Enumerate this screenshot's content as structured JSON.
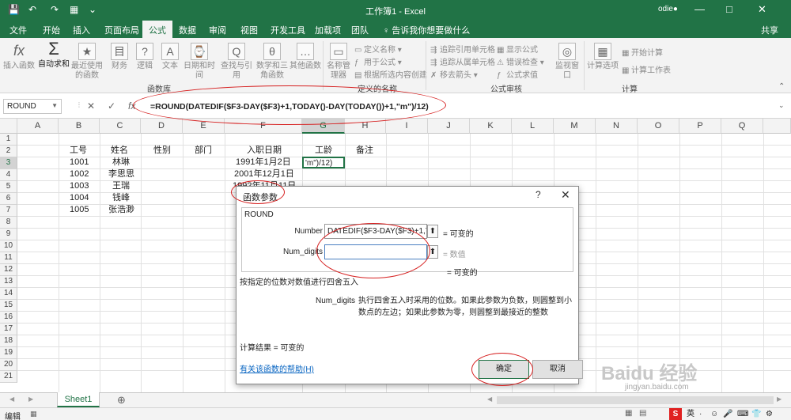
{
  "titlebar": {
    "title": "工作簿1 - Excel",
    "user": "odie●",
    "window_controls": [
      "—",
      "□",
      "✕"
    ]
  },
  "tabs": [
    "文件",
    "开始",
    "插入",
    "页面布局",
    "公式",
    "数据",
    "审阅",
    "视图",
    "开发工具",
    "加载项",
    "团队",
    "♀ 告诉我你想要做什么"
  ],
  "active_tab": "公式",
  "share": "共享",
  "ribbon": {
    "funclib": [
      {
        "icon": "fx",
        "label": "插入函数"
      },
      {
        "icon": "Σ",
        "label": "自动求和"
      },
      {
        "icon": "★",
        "label": "最近使用的函数"
      },
      {
        "icon": "目",
        "label": "财务"
      },
      {
        "icon": "?",
        "label": "逻辑"
      },
      {
        "icon": "A",
        "label": "文本"
      },
      {
        "icon": "⌚",
        "label": "日期和时间"
      },
      {
        "icon": "Q",
        "label": "查找与引用"
      },
      {
        "icon": "θ",
        "label": "数学和三角函数"
      },
      {
        "icon": "…",
        "label": "其他函数"
      }
    ],
    "name_manager": "名称管理器",
    "names_small": [
      "定义名称 ▾",
      "用于公式 ▾",
      "根据所选内容创建"
    ],
    "audit_small": [
      "追踪引用单元格",
      "追踪从属单元格",
      "移去箭头 ▾",
      "显示公式",
      "错误检查 ▾",
      "公式求值"
    ],
    "watch": "监视窗口",
    "calc_options": "计算选项",
    "calc_small": [
      "开始计算",
      "计算工作表"
    ],
    "groups": [
      "函数库",
      "定义的名称",
      "公式审核",
      "计算"
    ]
  },
  "formula_bar": {
    "name_box": "ROUND",
    "formula": "=ROUND(DATEDIF($F3-DAY($F3)+1,TODAY()-DAY(TODAY())+1,\"m\")/12)",
    "buttons": [
      "✕",
      "✓",
      "fx"
    ]
  },
  "columns": [
    "A",
    "B",
    "C",
    "D",
    "E",
    "F",
    "G",
    "H",
    "I",
    "J",
    "K",
    "L",
    "M",
    "N",
    "O",
    "P",
    "Q"
  ],
  "rows": [
    "1",
    "2",
    "3",
    "4",
    "5",
    "6",
    "7",
    "8",
    "9",
    "10",
    "11",
    "12",
    "13",
    "14",
    "15",
    "16",
    "17",
    "18",
    "19",
    "20",
    "21"
  ],
  "headers": {
    "id": "工号",
    "name": "姓名",
    "gender": "性别",
    "dept": "部门",
    "date": "入职日期",
    "years": "工龄",
    "notes": "备注"
  },
  "employees": [
    {
      "id": "1001",
      "name": "林琳",
      "date": "1991年1月2日"
    },
    {
      "id": "1002",
      "name": "李思思",
      "date": "2001年12月1日"
    },
    {
      "id": "1003",
      "name": "王瑞",
      "date": "1992年11月11日"
    },
    {
      "id": "1004",
      "name": "钱峰",
      "date": ""
    },
    {
      "id": "1005",
      "name": "张浩渺",
      "date": ""
    }
  ],
  "active_cell_text": "'m\")/12)",
  "dialog": {
    "title": "函数参数",
    "function": "ROUND",
    "arg1_label": "Number",
    "arg1_value": "DATEDIF($F3-DAY($F3)+1,TO",
    "arg1_result": "=  可变的",
    "arg2_label": "Num_digits",
    "arg2_value": "",
    "arg2_result": "=  数值",
    "total_result": "=  可变的",
    "description": "按指定的位数对数值进行四舍五入",
    "param_name": "Num_digits",
    "param_desc": "执行四舍五入时采用的位数。如果此参数为负数，则圆整到小数点的左边；如果此参数为零，则圆整到最接近的整数",
    "calc_result": "计算结果 =  可变的",
    "help_link": "有关该函数的帮助(H)",
    "ok": "确定",
    "cancel": "取消"
  },
  "sheet_tab": "Sheet1",
  "add_sheet": "⊕",
  "status_mode": "编辑",
  "tray": [
    "英",
    "·",
    "☺",
    "🎤",
    "⌨",
    "👕",
    "⚙"
  ],
  "watermark": [
    "Baidu 经验",
    "jingyan.baidu.com"
  ]
}
